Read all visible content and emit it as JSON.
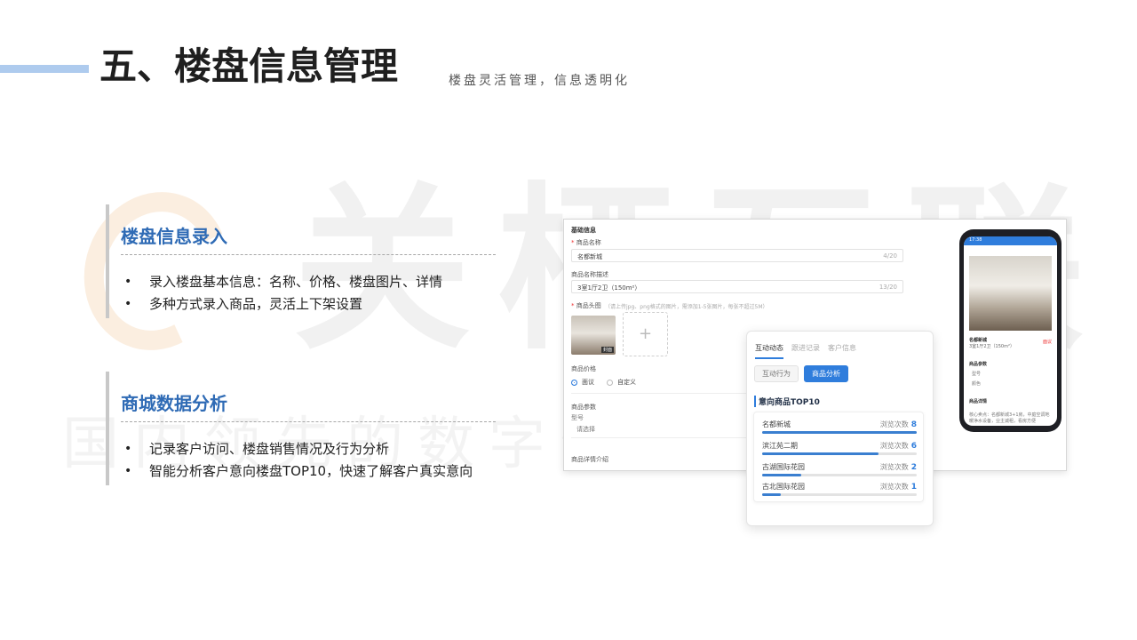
{
  "page": {
    "title": "五、楼盘信息管理",
    "subtitle": "楼盘灵活管理，信息透明化",
    "watermark": "关栖互联",
    "watermark_sub": "国内领先的数字化营销服务商"
  },
  "sections": [
    {
      "heading": "楼盘信息录入",
      "bullets": [
        "录入楼盘基本信息：名称、价格、楼盘图片、详情",
        "多种方式录入商品，灵活上下架设置"
      ]
    },
    {
      "heading": "商城数据分析",
      "bullets": [
        "记录客户访问、楼盘销售情况及行为分析",
        "智能分析客户意向楼盘TOP10，快速了解客户真实意向"
      ]
    }
  ],
  "form": {
    "section_title": "基础信息",
    "name_label": "商品名称",
    "name_value": "名都新城",
    "name_count": "4/20",
    "desc_label": "商品名称描述",
    "desc_value": "3室1厅2卫（150m²）",
    "desc_count": "13/20",
    "image_label": "商品头图",
    "image_hint": "（请上传jpg、png格式的图片，需添加1-5张图片，每张不超过5M）",
    "thumb_tag": "封面",
    "uploader_plus": "+",
    "price_label": "商品价格",
    "price_options": [
      "面议",
      "自定义"
    ],
    "params_label": "商品参数",
    "params_item": "型号",
    "params_placeholder": "请选择",
    "detail_label": "商品详情介绍",
    "req_mark": "*"
  },
  "analytics": {
    "tabs": [
      "互动动态",
      "跟进记录",
      "客户信息"
    ],
    "pills": [
      "互动行为",
      "商品分析"
    ],
    "top_title": "意向商品TOP10",
    "views_label": "浏览次数",
    "items": [
      {
        "name": "名都新城",
        "views": "8",
        "fill": 1.0
      },
      {
        "name": "滨江苑二期",
        "views": "6",
        "fill": 0.75
      },
      {
        "name": "古湖国际花园",
        "views": "2",
        "fill": 0.25
      },
      {
        "name": "古北国际花园",
        "views": "1",
        "fill": 0.12
      }
    ]
  },
  "phone": {
    "status": "17:38",
    "name": "名都新城",
    "sub": "3室1厅2卫（150m²）",
    "price": "面议",
    "params_title": "商品参数",
    "params_items": [
      "型号",
      "颜色"
    ],
    "detail_title": "商品详情",
    "detail_text": "核心卖点：名都新城3+1房，中庭空调地暖净水设备，业主诚租，看房方便"
  },
  "colors": {
    "accent": "#2f7ddc",
    "heading_blue": "#2f6bb5",
    "title_bar": "#aecbee"
  }
}
